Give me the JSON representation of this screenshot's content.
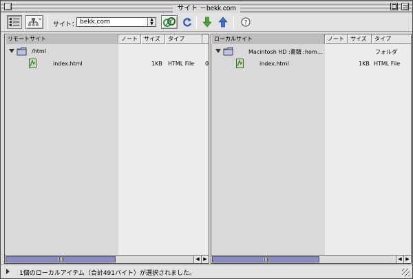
{
  "window": {
    "title": "サイト －bekk.com"
  },
  "toolbar": {
    "site_label": "サイト：",
    "site_value": "bekk.com",
    "buttons": [
      "site-files-view-icon",
      "site-map-view-icon",
      "connect-icon",
      "refresh-icon",
      "get-icon",
      "put-icon",
      "help-icon"
    ]
  },
  "remote": {
    "columns": [
      "リモートサイト",
      "ノート",
      "サイズ",
      "タイプ"
    ],
    "root_name": "/html",
    "files": [
      {
        "name": "index.html",
        "size": "1KB",
        "type": "HTML File",
        "extra": "0"
      }
    ]
  },
  "local": {
    "columns": [
      "ローカルサイト",
      "ノート",
      "サイズ",
      "タイプ"
    ],
    "root_name": "Macintosh HD :書類 :hom...",
    "root_type": "フォルダ",
    "files": [
      {
        "name": "index.html",
        "size": "1KB",
        "type": "HTML File"
      }
    ]
  },
  "status": {
    "text": "1個のローカルアイテム（合計491バイト）が選択されました。"
  },
  "colors": {
    "scroll_thumb": "#8b8bc8",
    "connect_green": "#2e9b2e",
    "refresh_blue": "#1f5fd0"
  }
}
